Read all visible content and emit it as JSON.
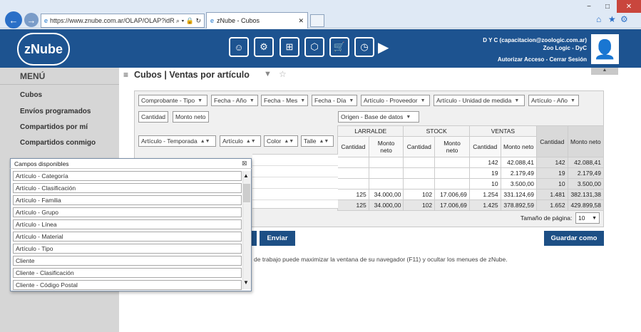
{
  "browser": {
    "url": "https://www.znube.com.ar/OLAP/OLAP?idR",
    "tab_title": "zNube - Cubos",
    "back": "←",
    "fwd": "→",
    "minimize": "−",
    "maximize": "□",
    "close": "✕"
  },
  "header": {
    "logo": "zNube",
    "user": "D Y C (capacitacion@zoologic.com.ar)",
    "company": "Zoo Logic - DyC",
    "links": "Autorizar Acceso - Cerrar Sesión"
  },
  "sidebar": {
    "title": "MENÚ",
    "items": [
      "Cubos",
      "Envíos programados",
      "Compartidos por mí",
      "Compartidos conmigo"
    ]
  },
  "page": {
    "title": "Cubos | Ventas por artículo"
  },
  "filters": {
    "row1": [
      "Comprobante - Tipo",
      "Fecha - Año",
      "Fecha - Mes",
      "Fecha - Día",
      "Artículo - Proveedor",
      "Artículo - Unidad de medida",
      "Artículo - Año"
    ],
    "data_fields": [
      "Cantidad",
      "Monto neto"
    ],
    "column_field": "Origen - Base de datos",
    "row_fields": [
      "Artículo - Temporada",
      "Artículo",
      "Color",
      "Talle"
    ]
  },
  "pivot": {
    "col_groups": [
      "LARRALDE",
      "STOCK",
      "VENTAS"
    ],
    "sub_headers": [
      "Cantidad",
      "Monto neto"
    ],
    "rows": [
      [
        "",
        "",
        "",
        "",
        "142",
        "42.088,41",
        "142",
        "42.088,41"
      ],
      [
        "",
        "",
        "",
        "",
        "19",
        "2.179,49",
        "19",
        "2.179,49"
      ],
      [
        "",
        "",
        "",
        "",
        "10",
        "3.500,00",
        "10",
        "3.500,00"
      ],
      [
        "125",
        "34.000,00",
        "102",
        "17.006,69",
        "1.254",
        "331.124,69",
        "1.481",
        "382.131,38"
      ],
      [
        "125",
        "34.000,00",
        "102",
        "17.006,69",
        "1.425",
        "378.892,59",
        "1.652",
        "429.899,58"
      ]
    ]
  },
  "pager": {
    "label": "Tamaño de página:",
    "value": "10"
  },
  "buttons": {
    "send": "Enviar",
    "save_as": "Guardar como"
  },
  "note": "de trabajo puede maximizar la ventana de su navegador (F11) y ocultar los menues de zNube.",
  "popup": {
    "title": "Campos disponibles",
    "fields": [
      "Artículo - Categoría",
      "Artículo - Clasificación",
      "Artículo - Familia",
      "Artículo - Grupo",
      "Artículo - Línea",
      "Artículo - Material",
      "Artículo - Tipo",
      "Cliente",
      "Cliente - Clasificación",
      "Cliente - Código Postal"
    ]
  },
  "colors": {
    "brand": "#1d5390",
    "button": "#1d4f85"
  }
}
